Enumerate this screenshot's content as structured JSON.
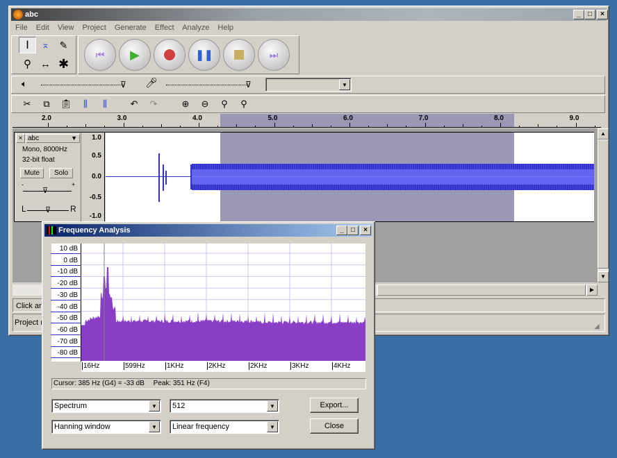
{
  "main_window": {
    "title": "abc",
    "menu": [
      "File",
      "Edit",
      "View",
      "Project",
      "Generate",
      "Effect",
      "Analyze",
      "Help"
    ],
    "ruler_ticks": [
      "2.0",
      "3.0",
      "4.0",
      "5.0",
      "6.0",
      "7.0",
      "8.0",
      "9.0"
    ],
    "track": {
      "name": "abc",
      "info1": "Mono, 8000Hz",
      "info2": "32-bit float",
      "mute": "Mute",
      "solo": "Solo",
      "pan_left": "L",
      "pan_right": "R",
      "gain_minus": "-",
      "gain_plus": "+",
      "scale": [
        "1.0",
        "0.5",
        "0.0",
        "-0.5",
        "-1.0"
      ]
    },
    "status_click": "Click an",
    "status_project": "Project ra"
  },
  "freq_dialog": {
    "title": "Frequency Analysis",
    "db_labels": [
      "10 dB",
      "0 dB",
      "-10 dB",
      "-20 dB",
      "-30 dB",
      "-40 dB",
      "-50 dB",
      "-60 dB",
      "-70 dB",
      "-80 dB"
    ],
    "freq_labels": [
      "16Hz",
      "599Hz",
      "1KHz",
      "2KHz",
      "2KHz",
      "3KHz",
      "4KHz"
    ],
    "cursor_text": "Cursor: 385 Hz (G4) = -33 dB",
    "peak_text": "Peak: 351 Hz (F4)",
    "algorithm": "Spectrum",
    "size": "512",
    "window_func": "Hanning window",
    "axis": "Linear frequency",
    "export_label": "Export...",
    "close_label": "Close",
    "spectrum_color": "#8a3ec6"
  }
}
